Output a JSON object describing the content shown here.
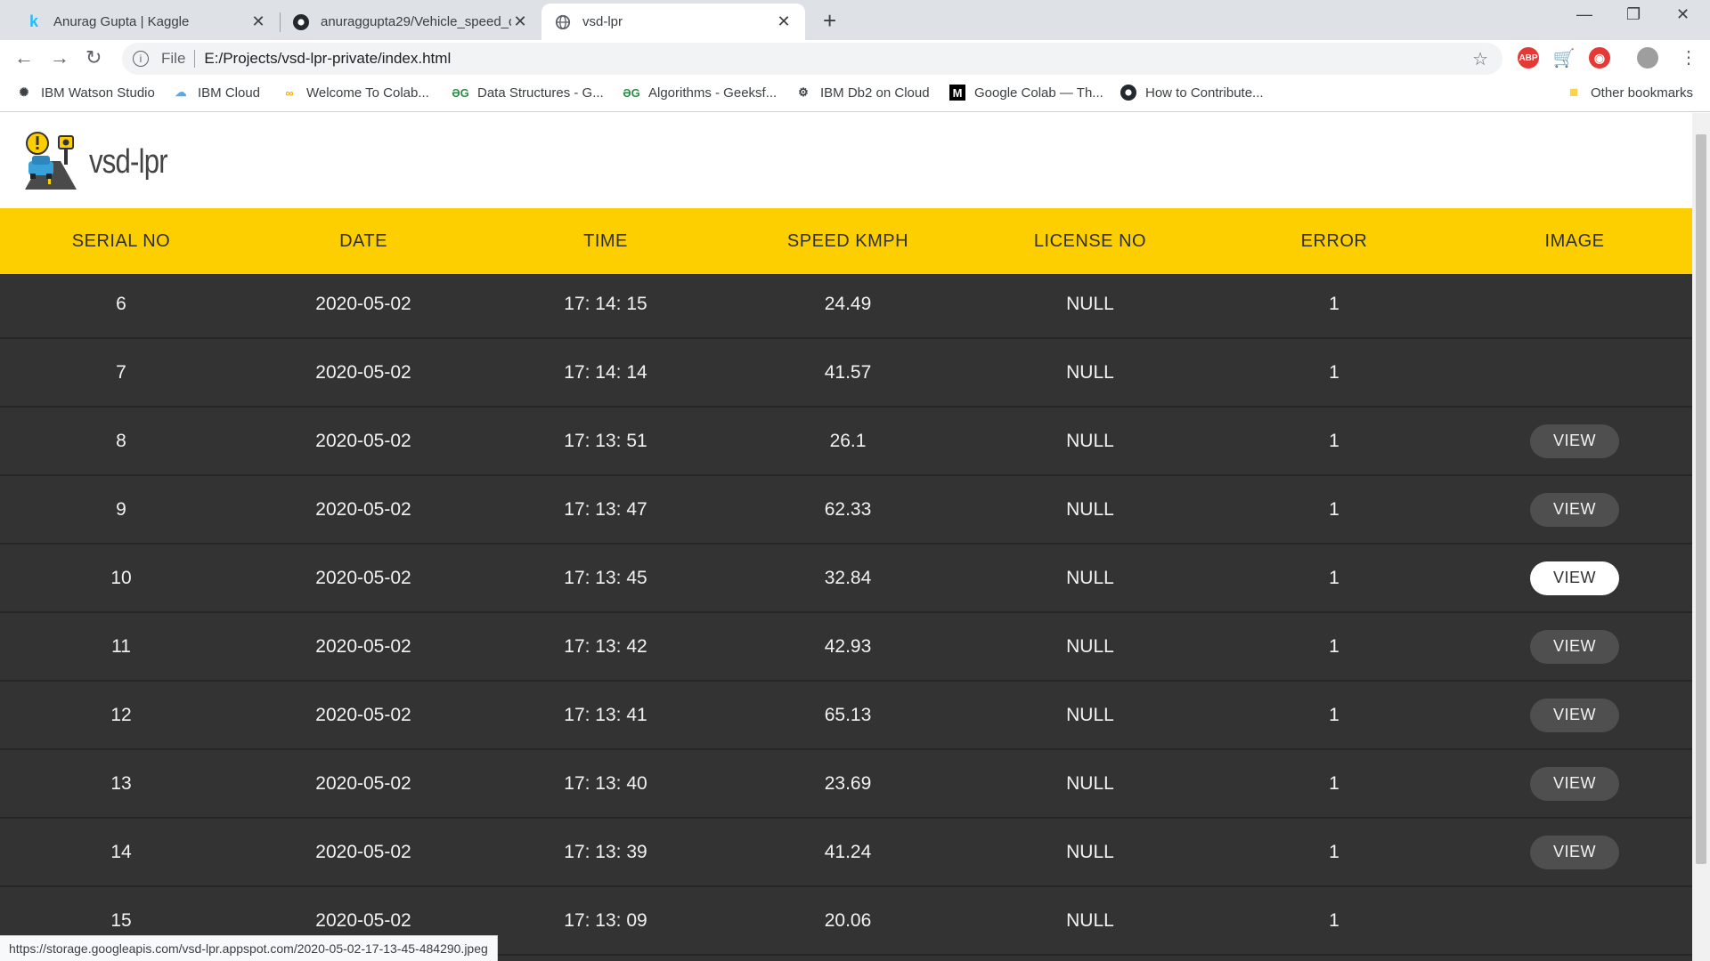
{
  "browser": {
    "tabs": [
      {
        "title": "Anurag Gupta | Kaggle",
        "icon": "kaggle-icon"
      },
      {
        "title": "anuraggupta29/Vehicle_speed_d",
        "icon": "github-icon"
      },
      {
        "title": "vsd-lpr",
        "icon": "globe-icon"
      }
    ],
    "address": {
      "scheme": "File",
      "url": "E:/Projects/vsd-lpr-private/index.html"
    },
    "bookmarks": [
      {
        "label": "IBM Watson Studio",
        "icon": "watson-icon"
      },
      {
        "label": "IBM Cloud",
        "icon": "cloud-icon"
      },
      {
        "label": "Welcome To Colab...",
        "icon": "colab-icon"
      },
      {
        "label": "Data Structures - G...",
        "icon": "geeksforgeeks-icon"
      },
      {
        "label": "Algorithms - Geeksf...",
        "icon": "geeksforgeeks-icon"
      },
      {
        "label": "IBM Db2 on Cloud",
        "icon": "db2-icon"
      },
      {
        "label": "Google Colab — Th...",
        "icon": "medium-icon"
      },
      {
        "label": "How to Contribute...",
        "icon": "github-icon"
      }
    ],
    "other_bookmarks": "Other bookmarks",
    "status_url": "https://storage.googleapis.com/vsd-lpr.appspot.com/2020-05-02-17-13-45-484290.jpeg",
    "extensions": {
      "abp": "ABP"
    }
  },
  "app": {
    "brand": "vsd-lpr",
    "accent_color": "#fecf00",
    "table_bg": "#333333",
    "columns": [
      "SERIAL NO",
      "DATE",
      "TIME",
      "SPEED KMPH",
      "LICENSE NO",
      "ERROR",
      "IMAGE"
    ],
    "rows": [
      {
        "serial": "6",
        "date": "2020-05-02",
        "time": "17: 14: 15",
        "speed": "24.49",
        "license": "NULL",
        "error": "1",
        "image": ""
      },
      {
        "serial": "7",
        "date": "2020-05-02",
        "time": "17: 14: 14",
        "speed": "41.57",
        "license": "NULL",
        "error": "1",
        "image": ""
      },
      {
        "serial": "8",
        "date": "2020-05-02",
        "time": "17: 13: 51",
        "speed": "26.1",
        "license": "NULL",
        "error": "1",
        "image": "VIEW"
      },
      {
        "serial": "9",
        "date": "2020-05-02",
        "time": "17: 13: 47",
        "speed": "62.33",
        "license": "NULL",
        "error": "1",
        "image": "VIEW"
      },
      {
        "serial": "10",
        "date": "2020-05-02",
        "time": "17: 13: 45",
        "speed": "32.84",
        "license": "NULL",
        "error": "1",
        "image": "VIEW"
      },
      {
        "serial": "11",
        "date": "2020-05-02",
        "time": "17: 13: 42",
        "speed": "42.93",
        "license": "NULL",
        "error": "1",
        "image": "VIEW"
      },
      {
        "serial": "12",
        "date": "2020-05-02",
        "time": "17: 13: 41",
        "speed": "65.13",
        "license": "NULL",
        "error": "1",
        "image": "VIEW"
      },
      {
        "serial": "13",
        "date": "2020-05-02",
        "time": "17: 13: 40",
        "speed": "23.69",
        "license": "NULL",
        "error": "1",
        "image": "VIEW"
      },
      {
        "serial": "14",
        "date": "2020-05-02",
        "time": "17: 13: 39",
        "speed": "41.24",
        "license": "NULL",
        "error": "1",
        "image": "VIEW"
      },
      {
        "serial": "15",
        "date": "2020-05-02",
        "time": "17: 13: 09",
        "speed": "20.06",
        "license": "NULL",
        "error": "1",
        "image": ""
      }
    ]
  }
}
